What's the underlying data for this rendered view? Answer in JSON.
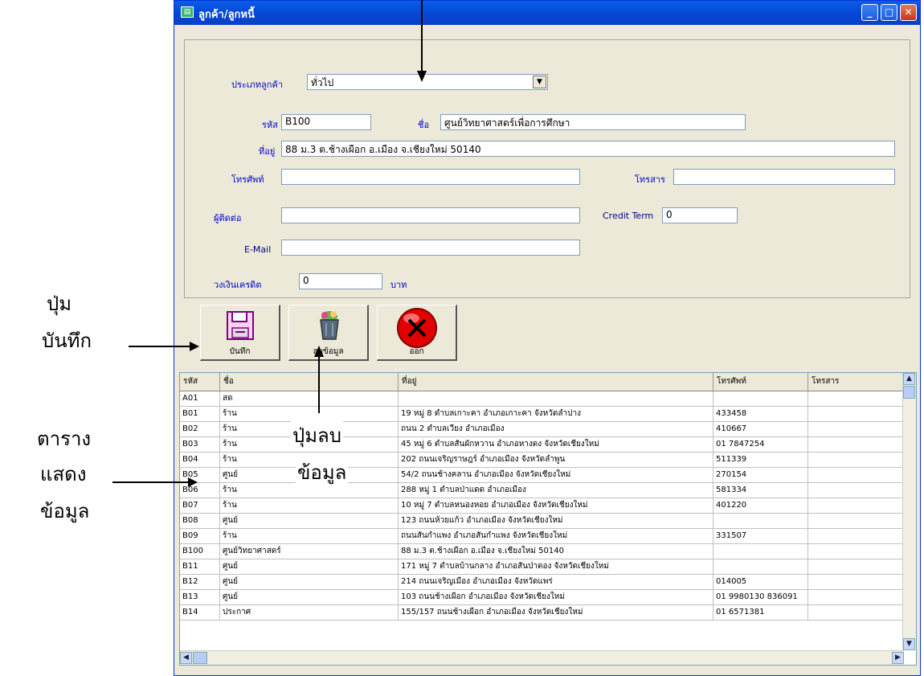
{
  "window": {
    "title": "ลูกค้า/ลูกหนี้",
    "minimize": "_",
    "maximize": "□",
    "close": "✕"
  },
  "form": {
    "customer_type_label": "ประเภทลูกค้า",
    "customer_type_value": "ทั่วไป",
    "code_label": "รหัส",
    "code_value": "B100",
    "name_label": "ชื่อ",
    "name_value": "ศูนย์วิทยาศาสตร์เพื่อการศึกษา",
    "address_label": "ที่อยู่",
    "address_value": "88 ม.3 ต.ช้างเผือก อ.เมือง จ.เชียงใหม่ 50140",
    "phone_label": "โทรศัพท์",
    "phone_value": "",
    "fax_label": "โทรสาร",
    "fax_value": "",
    "contact_label": "ผู้ติดต่อ",
    "contact_value": "",
    "credit_term_label": "Credit Term",
    "credit_term_value": "0",
    "email_label": "E-Mail",
    "email_value": "",
    "credit_limit_label": "วงเงินเครดิต",
    "credit_limit_value": "0",
    "credit_limit_unit": "บาท"
  },
  "buttons": {
    "save": "บันทึก",
    "delete": "ลบข้อมูล",
    "cancel": "ออก"
  },
  "grid": {
    "headers": [
      "รหัส",
      "ชื่อ",
      "ที่อยู่",
      "โทรศัพท์",
      "โทรสาร"
    ],
    "rows": [
      [
        "A01",
        "สด",
        "",
        "",
        ""
      ],
      [
        "B01",
        "ร้าน",
        "19 หมู่ 8 ตำบลเกาะคา อำเภอเกาะคา จังหวัดลำปาง",
        "433458",
        ""
      ],
      [
        "B02",
        "ร้าน",
        "ถนน 2 ตำบลเวียง อำเภอเมือง",
        "410667",
        ""
      ],
      [
        "B03",
        "ร้าน",
        "45 หมู่ 6 ตำบลสันผักหวาน อำเภอหางดง จังหวัดเชียงใหม่",
        "01 7847254",
        ""
      ],
      [
        "B04",
        "ร้าน",
        "202 ถนนเจริญราษฎร์ อำเภอเมือง จังหวัดลำพูน",
        "511339",
        ""
      ],
      [
        "B05",
        "ศูนย์",
        "54/2 ถนนช้างคลาน อำเภอเมือง จังหวัดเชียงใหม่",
        "270154",
        ""
      ],
      [
        "B06",
        "ร้าน",
        "288 หมู่ 1 ตำบลป่าแดด อำเภอเมือง",
        "581334",
        ""
      ],
      [
        "B07",
        "ร้าน",
        "10 หมู่ 7 ตำบลหนองหอย อำเภอเมือง จังหวัดเชียงใหม่",
        "401220",
        ""
      ],
      [
        "B08",
        "ศูนย์",
        "123 ถนนห้วยแก้ว อำเภอเมือง จังหวัดเชียงใหม่",
        "",
        ""
      ],
      [
        "B09",
        "ร้าน",
        "ถนนสันกำแพง อำเภอสันกำแพง จังหวัดเชียงใหม่",
        "331507",
        ""
      ],
      [
        "B100",
        "ศูนย์วิทยาศาสตร์",
        "88 ม.3 ต.ช้างเผือก อ.เมือง จ.เชียงใหม่ 50140",
        "",
        ""
      ],
      [
        "B11",
        "ศูนย์",
        "171 หมู่ 7 ตำบลบ้านกลาง อำเภอสันป่าตอง จังหวัดเชียงใหม่",
        "",
        ""
      ],
      [
        "B12",
        "ศูนย์",
        "214 ถนนเจริญเมือง อำเภอเมือง จังหวัดแพร่",
        "014005",
        ""
      ],
      [
        "B13",
        "ศูนย์",
        "103 ถนนช้างเผือก อำเภอเมือง จังหวัดเชียงใหม่",
        "01 9980130 836091",
        ""
      ],
      [
        "B14",
        "ประกาศ",
        "155/157 ถนนช้างเผือก อำเภอเมือง จังหวัดเชียงใหม่",
        "01 6571381",
        ""
      ]
    ]
  },
  "annotations": {
    "save_line1": "ปุ่ม",
    "save_line2": "บันทึก",
    "table_line1": "ตาราง",
    "table_line2": "แสดง",
    "table_line3": "ข้อมูล",
    "delete_line1": "ปุ่มลบ",
    "delete_line2": "ข้อมูล"
  }
}
